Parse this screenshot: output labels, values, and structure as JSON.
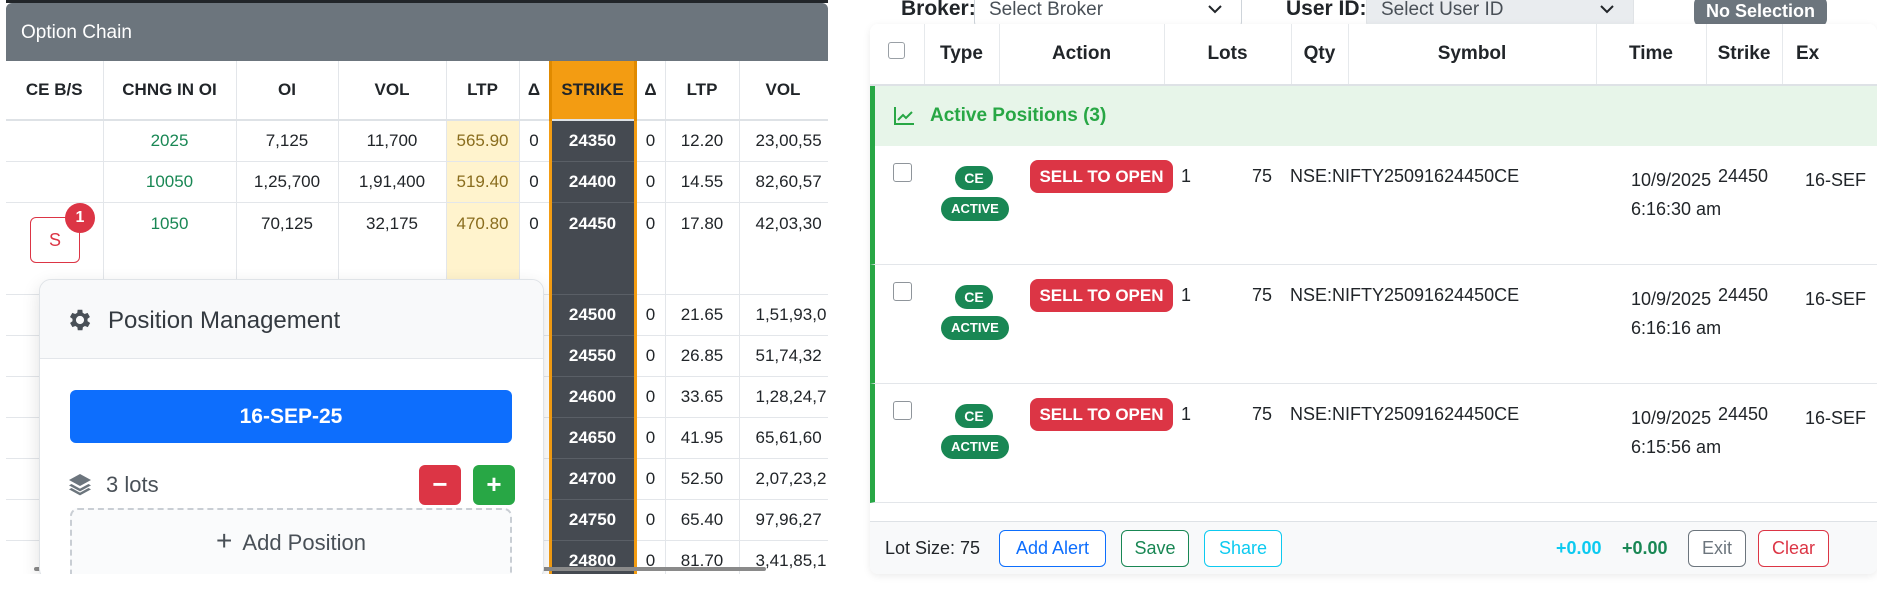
{
  "chain": {
    "title": "Option Chain",
    "columns": [
      "CE B/S",
      "CHNG IN OI",
      "OI",
      "VOL",
      "LTP",
      "Δ",
      "STRIKE",
      "Δ",
      "LTP",
      "VOL"
    ],
    "rows": [
      {
        "bs": "",
        "chng": "2025",
        "oi": "7,125",
        "vol": "11,700",
        "ltp": "565.90",
        "delta": "0",
        "strike": "24350",
        "pdelta": "0",
        "pltp": "12.20",
        "pvol": "23,00,55"
      },
      {
        "bs": "",
        "chng": "10050",
        "oi": "1,25,700",
        "vol": "1,91,400",
        "ltp": "519.40",
        "delta": "0",
        "strike": "24400",
        "pdelta": "0",
        "pltp": "14.55",
        "pvol": "82,60,57"
      },
      {
        "bs": "",
        "chng": "1050",
        "oi": "70,125",
        "vol": "32,175",
        "ltp": "470.80",
        "delta": "0",
        "strike": "24450",
        "pdelta": "0",
        "pltp": "17.80",
        "pvol": "42,03,30"
      },
      {
        "bs": "",
        "chng": "",
        "oi": "",
        "vol": "",
        "ltp": "",
        "delta": "0",
        "strike": "24500",
        "pdelta": "0",
        "pltp": "21.65",
        "pvol": "1,51,93,0"
      },
      {
        "bs": "",
        "chng": "",
        "oi": "",
        "vol": "",
        "ltp": "",
        "delta": "0",
        "strike": "24550",
        "pdelta": "0",
        "pltp": "26.85",
        "pvol": "51,74,32"
      },
      {
        "bs": "",
        "chng": "",
        "oi": "",
        "vol": "",
        "ltp": "",
        "delta": "0",
        "strike": "24600",
        "pdelta": "0",
        "pltp": "33.65",
        "pvol": "1,28,24,7"
      },
      {
        "bs": "",
        "chng": "",
        "oi": "",
        "vol": "",
        "ltp": "",
        "delta": "0",
        "strike": "24650",
        "pdelta": "0",
        "pltp": "41.95",
        "pvol": "65,61,60"
      },
      {
        "bs": "",
        "chng": "",
        "oi": "",
        "vol": "",
        "ltp": "",
        "delta": "0",
        "strike": "24700",
        "pdelta": "0",
        "pltp": "52.50",
        "pvol": "2,07,23,2"
      },
      {
        "bs": "",
        "chng": "",
        "oi": "",
        "vol": "",
        "ltp": "",
        "delta": "0",
        "strike": "24750",
        "pdelta": "0",
        "pltp": "65.40",
        "pvol": "97,96,27"
      },
      {
        "bs": "",
        "chng": "",
        "oi": "",
        "vol": "",
        "ltp": "",
        "delta": "0",
        "strike": "24800",
        "pdelta": "0",
        "pltp": "81.70",
        "pvol": "3,41,85,1"
      }
    ],
    "sell_button": "S",
    "sell_badge": "1"
  },
  "position_management": {
    "title": "Position Management",
    "expiry": "16-SEP-25",
    "lots": "3 lots",
    "minus": "−",
    "plus": "+",
    "add_position": "Add Position"
  },
  "topbar": {
    "broker_label": "Broker:",
    "broker_value": "Select Broker",
    "user_label": "User ID:",
    "user_value": "Select User ID",
    "selection_badge": "No Selection"
  },
  "positions": {
    "columns": [
      "Type",
      "Action",
      "Lots",
      "Qty",
      "Symbol",
      "Time",
      "Strike",
      "Ex"
    ],
    "group_label": "Active Positions (3)",
    "rows": [
      {
        "type": "CE",
        "status": "ACTIVE",
        "action": "SELL TO OPEN",
        "lots": "1",
        "qty": "75",
        "symbol": "NSE:NIFTY25091624450CE",
        "time": "10/9/2025 6:16:30 am",
        "strike": "24450",
        "expiry": "16-SEF"
      },
      {
        "type": "CE",
        "status": "ACTIVE",
        "action": "SELL TO OPEN",
        "lots": "1",
        "qty": "75",
        "symbol": "NSE:NIFTY25091624450CE",
        "time": "10/9/2025 6:16:16 am",
        "strike": "24450",
        "expiry": "16-SEF"
      },
      {
        "type": "CE",
        "status": "ACTIVE",
        "action": "SELL TO OPEN",
        "lots": "1",
        "qty": "75",
        "symbol": "NSE:NIFTY25091624450CE",
        "time": "10/9/2025 6:15:56 am",
        "strike": "24450",
        "expiry": "16-SEF"
      }
    ],
    "footer": {
      "lot_size": "Lot Size: 75",
      "add_alert": "Add Alert",
      "save": "Save",
      "share": "Share",
      "pnl_1": "+0.00",
      "pnl_2": "+0.00",
      "exit": "Exit",
      "clear": "Clear"
    }
  },
  "colors": {
    "strike_header": "#f39c12",
    "strike_cell": "#454a51",
    "sell": "#dc3545",
    "active_green": "#28a745",
    "primary": "#0d6efd"
  },
  "icons": [
    "gear-icon",
    "layers-icon",
    "plus-icon",
    "chevron-down-icon",
    "chart-line-icon"
  ]
}
